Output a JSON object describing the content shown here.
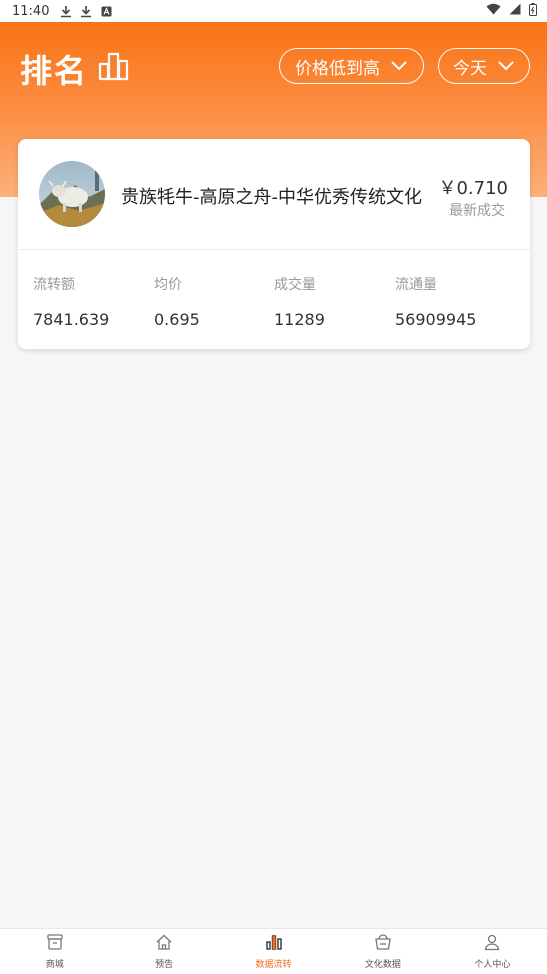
{
  "status_bar": {
    "time": "11:40",
    "icons": [
      "download-icon",
      "download-icon",
      "app-icon"
    ],
    "right_icons": [
      "wifi-icon",
      "signal-icon",
      "battery-icon"
    ]
  },
  "header": {
    "title": "排名",
    "sort_filter": "价格低到高",
    "date_filter": "今天"
  },
  "card": {
    "name": "贵族牦牛-高原之舟-中华优秀传统文化",
    "price": "￥0.710",
    "price_label": "最新成交",
    "stats": [
      {
        "label": "流转额",
        "value": "7841.639"
      },
      {
        "label": "均价",
        "value": "0.695"
      },
      {
        "label": "成交量",
        "value": "11289"
      },
      {
        "label": "流通量",
        "value": "56909945"
      }
    ]
  },
  "tabs": [
    {
      "label": "商城",
      "icon": "shop-icon"
    },
    {
      "label": "预告",
      "icon": "home-icon"
    },
    {
      "label": "数据流转",
      "icon": "bar-chart-icon"
    },
    {
      "label": "文化数据",
      "icon": "basket-icon"
    },
    {
      "label": "个人中心",
      "icon": "user-icon"
    }
  ],
  "colors": {
    "accent": "#f36b21",
    "header_gradient_top": "#f97316",
    "header_gradient_bottom": "#fdb07a"
  }
}
